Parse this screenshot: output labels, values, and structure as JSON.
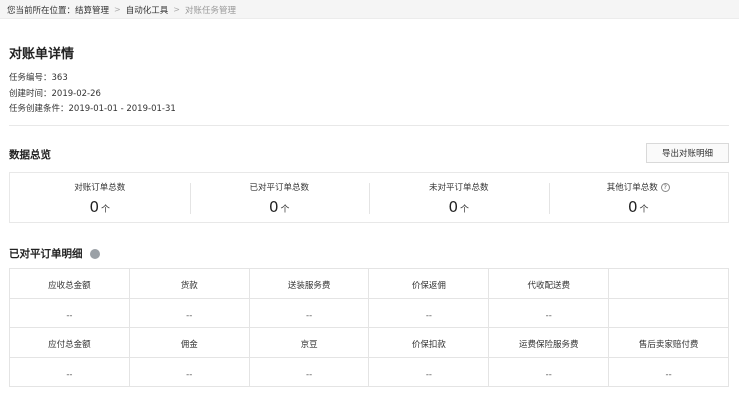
{
  "breadcrumb": {
    "prefix": "您当前所在位置：",
    "items": [
      "结算管理",
      "自动化工具",
      "对账任务管理"
    ]
  },
  "page": {
    "title": "对账单详情"
  },
  "meta": {
    "task_no": "任务编号：363",
    "created": "创建时间：2019-02-26",
    "condition": "任务创建条件：2019-01-01 - 2019-01-31"
  },
  "summary": {
    "title": "数据总览",
    "export_label": "导出对账明细",
    "stats": [
      {
        "label": "对账订单总数",
        "value": "0",
        "unit": "个"
      },
      {
        "label": "已对平订单总数",
        "value": "0",
        "unit": "个"
      },
      {
        "label": "未对平订单总数",
        "value": "0",
        "unit": "个"
      },
      {
        "label": "其他订单总数",
        "value": "0",
        "unit": "个"
      }
    ]
  },
  "detail": {
    "title": "已对平订单明细",
    "rows": [
      {
        "headers": [
          "应收总金额",
          "货款",
          "送装服务费",
          "价保返佣",
          "代收配送费",
          ""
        ],
        "values": [
          "--",
          "--",
          "--",
          "--",
          "--",
          ""
        ]
      },
      {
        "headers": [
          "应付总金额",
          "佣金",
          "京豆",
          "价保扣款",
          "运费保险服务费",
          "售后卖家赔付费"
        ],
        "values": [
          "--",
          "--",
          "--",
          "--",
          "--",
          "--"
        ]
      }
    ]
  }
}
